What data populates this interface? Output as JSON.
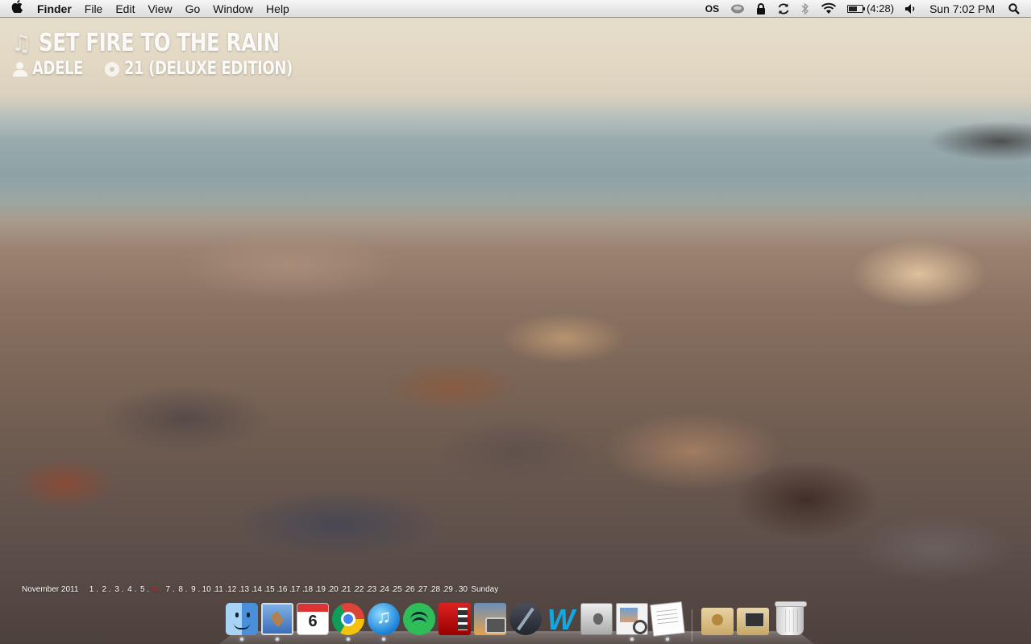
{
  "menubar": {
    "apple": "",
    "app_name": "Finder",
    "menus": [
      "File",
      "Edit",
      "View",
      "Go",
      "Window",
      "Help"
    ],
    "status": {
      "lastfm": "OS",
      "battery_time": "(4:28)",
      "battery_level": 0.6,
      "clock": "Sun 7:02 PM"
    }
  },
  "now_playing": {
    "title": "SET FIRE TO THE RAIN",
    "artist": "ADELE",
    "album": "21 (DELUXE EDITION)"
  },
  "calendar": {
    "month": "November 2011",
    "days": [
      "1",
      "2",
      "3",
      "4",
      "5",
      "6",
      "7",
      "8",
      "9",
      "10",
      "11",
      "12",
      "13",
      "14",
      "15",
      "16",
      "17",
      "18",
      "19",
      "20",
      "21",
      "22",
      "23",
      "24",
      "25",
      "26",
      "27",
      "28",
      "29",
      "30"
    ],
    "today": "6",
    "weekday": "Sunday"
  },
  "dock": {
    "calendar_date": "6",
    "apps": [
      {
        "name": "finder",
        "running": true
      },
      {
        "name": "mail",
        "running": true
      },
      {
        "name": "ical",
        "running": false
      },
      {
        "name": "chrome",
        "running": true
      },
      {
        "name": "itunes",
        "running": true
      },
      {
        "name": "spotify",
        "running": false
      },
      {
        "name": "photo-booth",
        "running": false
      },
      {
        "name": "iphoto",
        "running": false
      },
      {
        "name": "xcode",
        "running": false
      },
      {
        "name": "wordpress",
        "running": false
      },
      {
        "name": "boot-camp",
        "running": false
      },
      {
        "name": "preview",
        "running": true
      },
      {
        "name": "textedit",
        "running": true
      },
      {
        "name": "downloads-folder",
        "running": false
      },
      {
        "name": "applications-folder",
        "running": false
      },
      {
        "name": "trash",
        "running": false
      }
    ]
  }
}
